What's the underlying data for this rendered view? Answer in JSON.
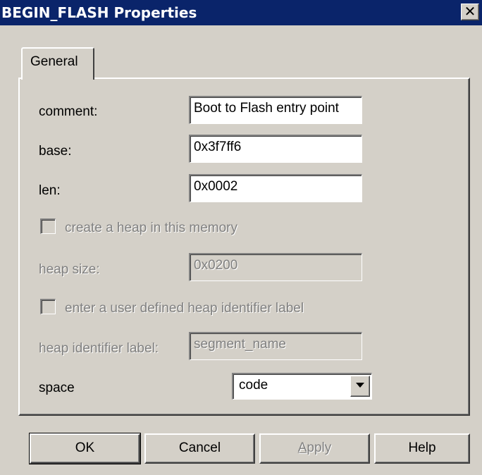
{
  "window": {
    "title": "BEGIN_FLASH Properties",
    "close_glyph": "✕"
  },
  "tabs": [
    {
      "label": "General",
      "selected": true
    }
  ],
  "form": {
    "comment": {
      "label": "comment:",
      "value": "Boot to Flash entry point"
    },
    "base": {
      "label": "base:",
      "value": "0x3f7ff6"
    },
    "len": {
      "label": "len:",
      "value": "0x0002"
    },
    "create_heap": {
      "label": "create a heap in this memory",
      "checked": false,
      "enabled": false
    },
    "heap_size": {
      "label": "heap size:",
      "value": "0x0200",
      "enabled": false
    },
    "user_heap_label": {
      "label": "enter a user defined heap identifier label",
      "checked": false,
      "enabled": false
    },
    "heap_identifier": {
      "label": "heap identifier label:",
      "value": "segment_name",
      "enabled": false
    },
    "space": {
      "label": "space",
      "selected": "code"
    }
  },
  "buttons": {
    "ok": "OK",
    "cancel": "Cancel",
    "apply_first": "A",
    "apply_rest": "pply",
    "help": "Help"
  },
  "icons": {
    "close": "close-icon",
    "dropdown": "chevron-down-icon"
  },
  "colors": {
    "titlebar": "#0a246a",
    "face": "#d4d0c8",
    "disabled_text": "#808080"
  }
}
